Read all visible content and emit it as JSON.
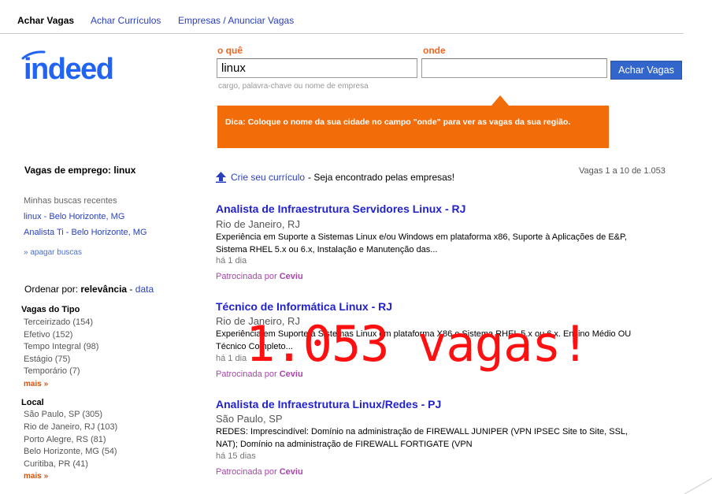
{
  "nav": {
    "items": [
      {
        "label": "Achar Vagas"
      },
      {
        "label": "Achar Currículos"
      },
      {
        "label": "Empresas / Anunciar Vagas"
      }
    ]
  },
  "logo": {
    "text": "indeed"
  },
  "search": {
    "what_label": "o quê",
    "what_value": "linux",
    "where_label": "onde",
    "where_value": "",
    "button": "Achar Vagas",
    "hint": "cargo, palavra-chave ou nome de empresa"
  },
  "tip": {
    "text": "Dica: Coloque o nome da sua cidade no campo \"onde\" para ver as vagas da sua região."
  },
  "sidebar": {
    "title_prefix": "Vagas de emprego: ",
    "title_query": "linux",
    "recent_label": "Minhas buscas recentes",
    "recent": [
      "linux - Belo Horizonte, MG",
      "Analista Ti - Belo Horizonte, MG"
    ],
    "clear": "» apagar buscas",
    "sort_label": "Ordenar por: ",
    "sort_selected": "relevância",
    "sort_sep": " - ",
    "sort_alt": "data",
    "facets": [
      {
        "title": "Vagas do Tipo",
        "items": [
          "Terceirizado (154)",
          "Efetivo (152)",
          "Tempo Integral (98)",
          "Estágio (75)",
          "Temporário (7)"
        ],
        "more": "mais »"
      },
      {
        "title": "Local",
        "items": [
          "São Paulo, SP (305)",
          "Rio de Janeiro, RJ (103)",
          "Porto Alegre, RS (81)",
          "Belo Horizonte, MG (54)",
          "Curitiba, PR (41)"
        ],
        "more": "mais »"
      }
    ]
  },
  "results": {
    "crie_link": "Crie seu currículo",
    "crie_text": "- Seja encontrado pelas empresas!",
    "count": "Vagas 1 a 10 de 1.053",
    "jobs": [
      {
        "title": "Analista de Infraestrutura Servidores Linux - RJ",
        "location": "Rio de Janeiro, RJ",
        "desc": "Experiência em Suporte a Sistemas Linux e/ou Windows em plataforma x86, Suporte à Aplicações de E&P, Sistema RHEL 5.x ou 6.x, Instalação e Manutenção das...",
        "age": "há 1 dia",
        "sponsor_prefix": "Patrocinada por ",
        "sponsor": "Ceviu"
      },
      {
        "title": "Técnico de Informática Linux - RJ",
        "location": "Rio de Janeiro, RJ",
        "desc": "Experiência em Suporte a Sistemas Linux em plataforma X86 e Sistema RHEL 5.x ou 6.x. Ensino Médio OU Técnico Completo...",
        "age": "há 1 dia",
        "sponsor_prefix": "Patrocinada por ",
        "sponsor": "Ceviu"
      },
      {
        "title": "Analista de Infraestrutura Linux/Redes - PJ",
        "location": "São Paulo, SP",
        "desc": "REDES: Imprescindível: Domínio na administração de FIREWALL JUNIPER (VPN IPSEC Site to Site, SSL, NAT); Domínio na administração de FIREWALL FORTIGATE (VPN",
        "age": "há 15 dias",
        "sponsor_prefix": "Patrocinada por ",
        "sponsor": "Ceviu"
      }
    ]
  },
  "overlay": {
    "text": "1.053 vagas!"
  },
  "colors": {
    "accent_orange": "#f26522",
    "link_blue": "#2a3fbf",
    "button_blue": "#3366cc",
    "overlay_red": "#ff1010"
  }
}
